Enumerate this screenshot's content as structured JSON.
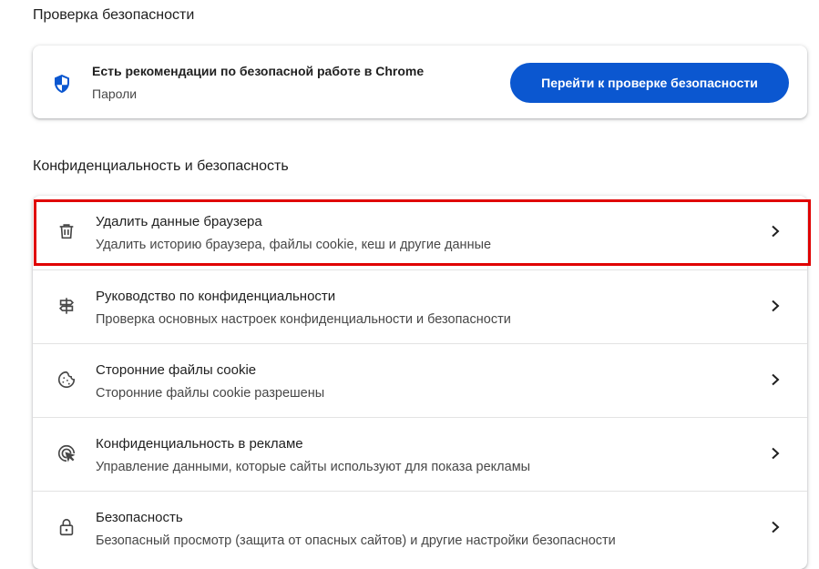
{
  "safety_check": {
    "section_title": "Проверка безопасности",
    "card_title": "Есть рекомендации по безопасной работе в Chrome",
    "card_subtitle": "Пароли",
    "button_label": "Перейти к проверке безопасности"
  },
  "privacy": {
    "section_title": "Конфиденциальность и безопасность",
    "items": [
      {
        "label": "Удалить данные браузера",
        "description": "Удалить историю браузера, файлы cookie, кеш и другие данные",
        "icon": "trash-icon",
        "highlighted": true
      },
      {
        "label": "Руководство по конфиденциальности",
        "description": "Проверка основных настроек конфиденциальности и безопасности",
        "icon": "signpost-icon"
      },
      {
        "label": "Сторонние файлы cookie",
        "description": "Сторонние файлы cookie разрешены",
        "icon": "cookie-icon"
      },
      {
        "label": "Конфиденциальность в рекламе",
        "description": "Управление данными, которые сайты используют для показа рекламы",
        "icon": "ad-privacy-icon"
      },
      {
        "label": "Безопасность",
        "description": "Безопасный просмотр (защита от опасных сайтов) и другие настройки безопасности",
        "icon": "lock-icon"
      }
    ]
  },
  "colors": {
    "primary_button": "#0b57d0",
    "highlight_border": "#e00000",
    "shield": "#0b57d0"
  }
}
